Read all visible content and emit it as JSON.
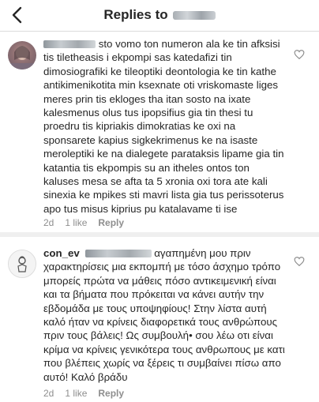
{
  "header": {
    "title": "Replies to"
  },
  "icons": {
    "back": "chevron-left-icon",
    "like": "heart-outline-icon"
  },
  "comments": [
    {
      "username": "",
      "body": "sto vomo ton numeron ala ke tin afksisi tis tiletheasis i ekpompi sas katedafizi tin dimosiografiki ke tileoptiki deontologia ke tin kathe antikimenikotita min ksexnate oti vriskomaste liges meres prin tis ekloges tha itan sosto na ixate kalesmenus olus tus ipopsifius gia tin thesi tu proedru tis kipriakis dimokratias ke oxi na sponsarete kapius sigkekrimenus ke na isaste meroleptiki ke na dialegete parataksis lipame gia tin katantia tis ekpompis su  an itheles ontos ton kaluses mesa se afta ta 5 xronia oxi tora ate kali sinexia ke mpikes sti mavri lista gia tus perissoterus apo tus misus kiprius pu katalavame ti ise",
      "age": "2d",
      "likes": "1 like",
      "reply": "Reply"
    },
    {
      "username": "con_ev",
      "body": "αγαπημένη μου πριν χαρακτηρίσεις μια εκπομπή με τόσο άσχημο τρόπο μπορείς πρώτα να μάθεις πόσο αντικειμενική είναι και τα βήματα που πρόκειται να κάνει αυτήν την εβδομάδα με τους υποψηφίους! Στην λίστα αυτή καλό ήταν να κρίνεις διαφορετικά τους ανθρώπους πριν τους βάλεις! Ως συμβουλή• σου λέω οτι είναι κρίμα να κρίνεις γενικότερα τους ανθρωπους με κατι που βλέπεις χωρίς να ξέρεις τι συμβαίνει πίσω απο αυτό! Καλό βράδυ",
      "age": "2d",
      "likes": "1 like",
      "reply": "Reply"
    }
  ],
  "colors": {
    "text": "#262626",
    "meta": "#8e8e8e",
    "divider": "#efefef"
  }
}
